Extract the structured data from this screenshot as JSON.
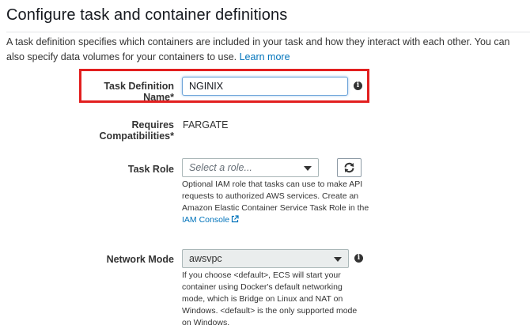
{
  "header": {
    "title": "Configure task and container definitions",
    "description": "A task definition specifies which containers are included in your task and how they interact with each other. You can also specify data volumes for your containers to use.",
    "learn_more": "Learn more"
  },
  "form": {
    "task_definition_name": {
      "label": "Task Definition Name*",
      "value": "NGINIX"
    },
    "requires_compatibilities": {
      "label": "Requires Compatibilities*",
      "value": "FARGATE"
    },
    "task_role": {
      "label": "Task Role",
      "placeholder": "Select a role...",
      "help": "Optional IAM role that tasks can use to make API requests to authorized AWS services. Create an Amazon Elastic Container Service Task Role in the",
      "help_link": "IAM Console"
    },
    "network_mode": {
      "label": "Network Mode",
      "value": "awsvpc",
      "help": "If you choose <default>, ECS will start your container using Docker's default networking mode, which is Bridge on Linux and NAT on Windows. <default> is the only supported mode on Windows."
    }
  },
  "colors": {
    "highlight": "#e21f1f",
    "link": "#0073bb"
  }
}
